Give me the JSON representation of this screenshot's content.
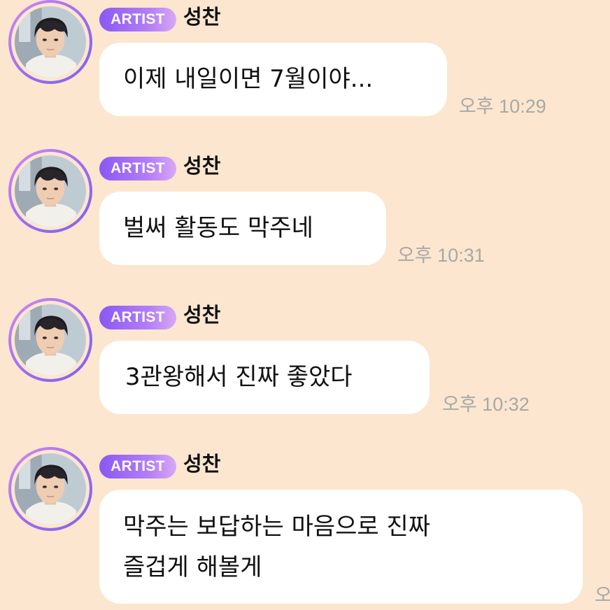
{
  "colors": {
    "background": "#fce6cf",
    "bubble": "#ffffff",
    "badge_start": "#8a58f4",
    "badge_end": "#d8a8f6",
    "timestamp": "#a8a8a8"
  },
  "messages": [
    {
      "badge": "ARTIST",
      "sender": "성찬",
      "text": "이제 내일이면 7월이야...",
      "time": "오후 10:29",
      "avatar_icon": "artist-profile-photo"
    },
    {
      "badge": "ARTIST",
      "sender": "성찬",
      "text": "벌써 활동도 막주네",
      "time": "오후 10:31",
      "avatar_icon": "artist-profile-photo"
    },
    {
      "badge": "ARTIST",
      "sender": "성찬",
      "text": " 3관왕해서 진짜 좋았다",
      "time": "오후 10:32",
      "avatar_icon": "artist-profile-photo"
    },
    {
      "badge": "ARTIST",
      "sender": "성찬",
      "text": "막주는 보답하는 마음으로 진짜\n즐겁게 해볼게",
      "time": "오",
      "avatar_icon": "artist-profile-photo"
    }
  ]
}
